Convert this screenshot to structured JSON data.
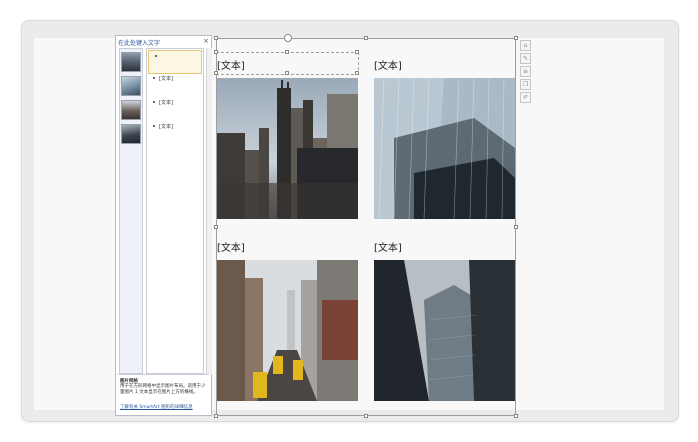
{
  "text_pane": {
    "title": "在此处键入文字",
    "close_glyph": "×",
    "bullets": [
      "",
      "[文本]",
      "[文本]",
      "[文本]"
    ],
    "footer_title": "图片网格",
    "footer_desc": "用于在方形网格中显示图片布局。适用于少量图片 1 文本显示在图片上方的横线。",
    "footer_link": "了解有关 SmartArt 图形的详细信息"
  },
  "smartart": {
    "labels": [
      "[文本]",
      "[文本]",
      "[文本]",
      "[文本]"
    ]
  },
  "side_tools": [
    "layout-icon",
    "brush-icon",
    "list-icon",
    "copy-icon",
    "edit-icon"
  ],
  "colors": {
    "accent": "#2b579a",
    "frame": "#ebebeb",
    "slide": "#f8f8f8"
  }
}
